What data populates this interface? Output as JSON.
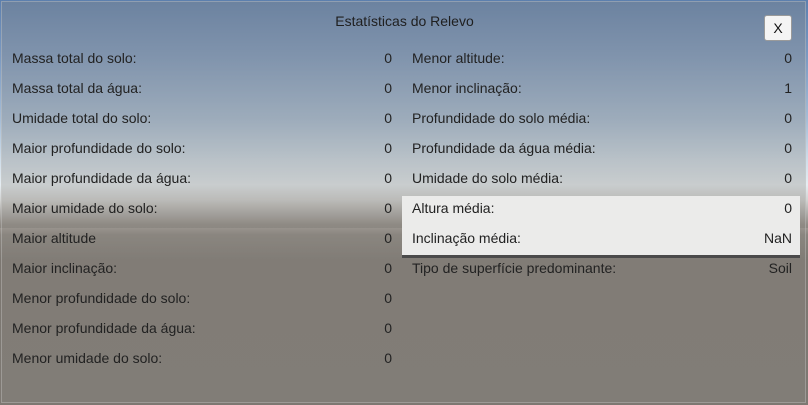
{
  "window": {
    "title": "Estatísticas do Relevo",
    "close_label": "X"
  },
  "stats_left": [
    {
      "label": "Massa total do solo:",
      "value": "0"
    },
    {
      "label": "Massa total da água:",
      "value": "0"
    },
    {
      "label": "Umidade total do solo:",
      "value": "0"
    },
    {
      "label": "Maior profundidade do solo:",
      "value": "0"
    },
    {
      "label": "Maior profundidade da água:",
      "value": "0"
    },
    {
      "label": "Maior umidade do solo:",
      "value": "0"
    },
    {
      "label": "Maior altitude",
      "value": "0"
    },
    {
      "label": "Maior inclinação:",
      "value": "0"
    },
    {
      "label": "Menor profundidade do solo:",
      "value": "0"
    },
    {
      "label": "Menor profundidade da água:",
      "value": "0"
    },
    {
      "label": "Menor umidade do solo:",
      "value": "0"
    }
  ],
  "stats_right": [
    {
      "label": "Menor altitude:",
      "value": "0"
    },
    {
      "label": "Menor inclinação:",
      "value": "1"
    },
    {
      "label": "Profundidade do solo média:",
      "value": "0"
    },
    {
      "label": "Profundidade da água média:",
      "value": "0"
    },
    {
      "label": "Umidade do solo média:",
      "value": "0"
    },
    {
      "label": "Altura média:",
      "value": "0"
    },
    {
      "label": "Inclinação média:",
      "value": "NaN"
    },
    {
      "label": "Tipo de superfície predominante:",
      "value": "Soil"
    }
  ]
}
